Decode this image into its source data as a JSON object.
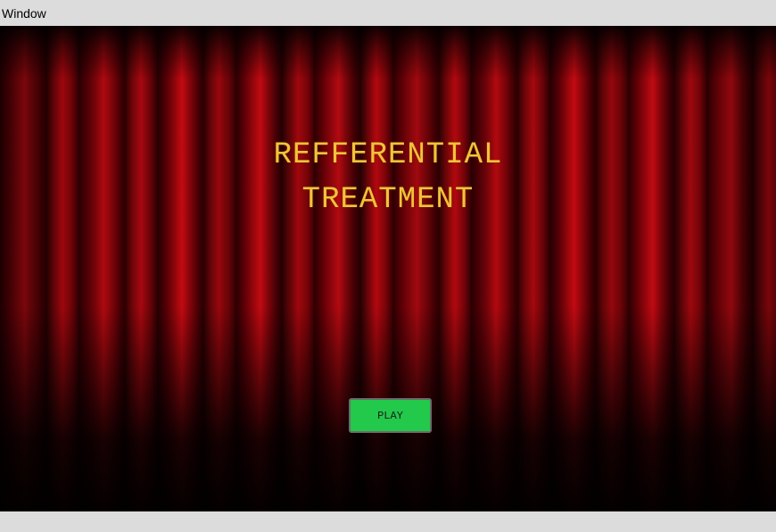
{
  "window": {
    "title": "Window"
  },
  "game": {
    "title_line1": "REFFERENTIAL",
    "title_line2": "TREATMENT",
    "play_label": "PLAY"
  },
  "colors": {
    "title_text": "#f2c33a",
    "play_button": "#22c94a",
    "curtain": "#a0070d"
  }
}
